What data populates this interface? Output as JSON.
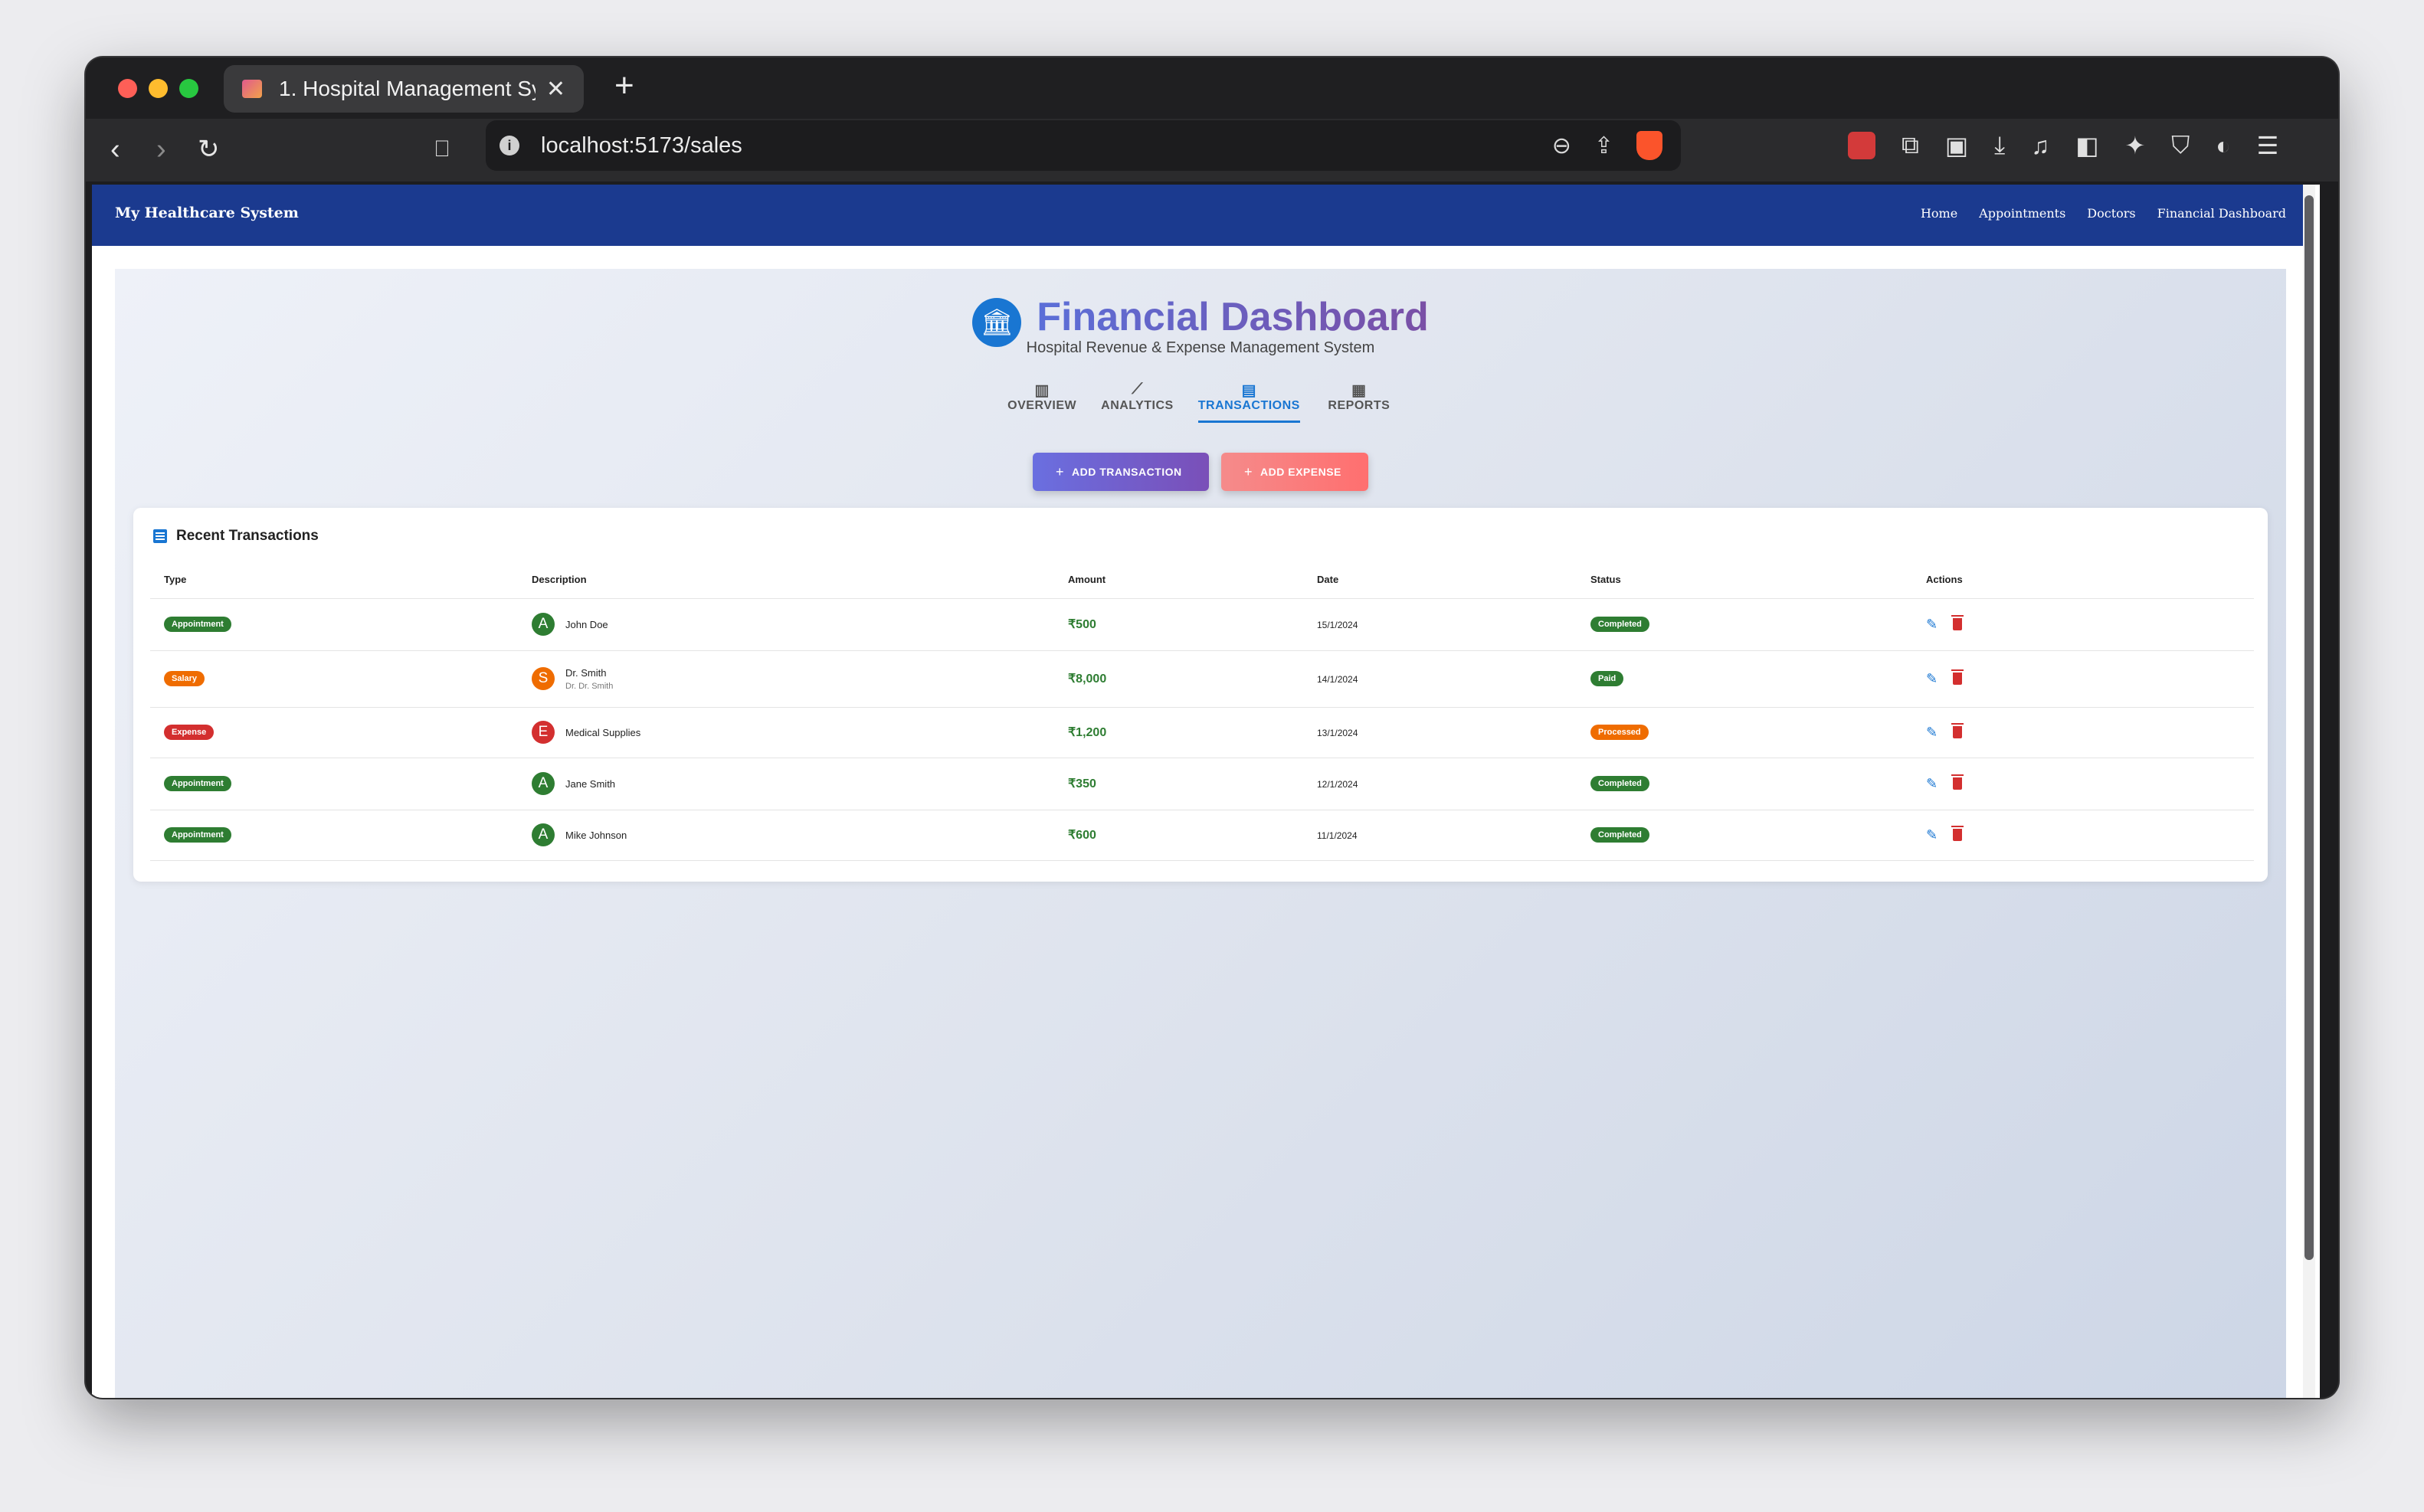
{
  "browser": {
    "tab_title": "1. Hospital Management Syste",
    "tab_close": "✕",
    "new_tab": "+",
    "url": "localhost:5173/sales",
    "info_icon": "i"
  },
  "app_nav": {
    "brand": "My Healthcare System",
    "links": [
      "Home",
      "Appointments",
      "Doctors",
      "Financial Dashboard"
    ]
  },
  "header": {
    "title": "Financial Dashboard",
    "subtitle": "Hospital Revenue & Expense Management System",
    "icon": "bank-icon"
  },
  "tabs": [
    {
      "label": "OVERVIEW",
      "icon": "bar-chart-icon"
    },
    {
      "label": "ANALYTICS",
      "icon": "trend-line-icon"
    },
    {
      "label": "TRANSACTIONS",
      "icon": "list-icon",
      "active": true
    },
    {
      "label": "REPORTS",
      "icon": "building-icon"
    }
  ],
  "actions": {
    "add_transaction": "ADD TRANSACTION",
    "add_expense": "ADD EXPENSE",
    "plus": "+"
  },
  "transactions": {
    "title": "Recent Transactions",
    "columns": [
      "Type",
      "Description",
      "Amount",
      "Date",
      "Status",
      "Actions"
    ],
    "rows": [
      {
        "type": "Appointment",
        "type_color": "#2e7d32",
        "avatar": "A",
        "avatar_color": "#2e7d32",
        "name": "John Doe",
        "sub": "",
        "amount": "₹500",
        "date": "15/1/2024",
        "status": "Completed",
        "status_color": "#2e7d32"
      },
      {
        "type": "Salary",
        "type_color": "#ef6c00",
        "avatar": "S",
        "avatar_color": "#ef6c00",
        "name": "Dr. Smith",
        "sub": "Dr. Dr. Smith",
        "amount": "₹8,000",
        "date": "14/1/2024",
        "status": "Paid",
        "status_color": "#2e7d32"
      },
      {
        "type": "Expense",
        "type_color": "#d32f2f",
        "avatar": "E",
        "avatar_color": "#d32f2f",
        "name": "Medical Supplies",
        "sub": "",
        "amount": "₹1,200",
        "date": "13/1/2024",
        "status": "Processed",
        "status_color": "#ef6c00"
      },
      {
        "type": "Appointment",
        "type_color": "#2e7d32",
        "avatar": "A",
        "avatar_color": "#2e7d32",
        "name": "Jane Smith",
        "sub": "",
        "amount": "₹350",
        "date": "12/1/2024",
        "status": "Completed",
        "status_color": "#2e7d32"
      },
      {
        "type": "Appointment",
        "type_color": "#2e7d32",
        "avatar": "A",
        "avatar_color": "#2e7d32",
        "name": "Mike Johnson",
        "sub": "",
        "amount": "₹600",
        "date": "11/1/2024",
        "status": "Completed",
        "status_color": "#2e7d32"
      }
    ]
  }
}
